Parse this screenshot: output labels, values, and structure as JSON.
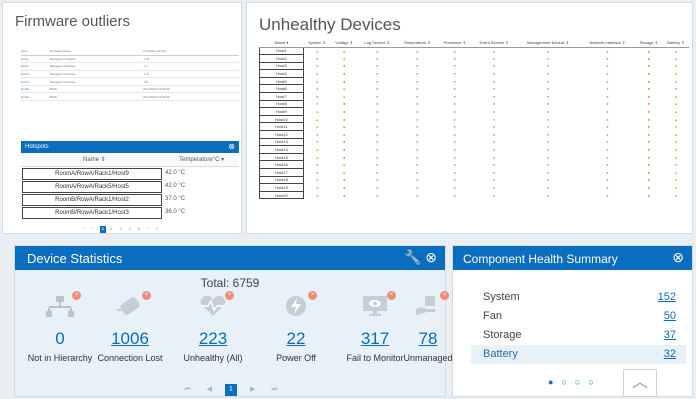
{
  "firmware": {
    "title": "Firmware outliers",
    "columns": [
      "Host",
      "Firmware Name",
      "Firmware Version"
    ],
    "rows": [
      [
        "Host1",
        "Manageent Module",
        "1.73"
      ],
      [
        "Host2",
        "Manageent Module",
        "1.7"
      ],
      [
        "Host3",
        "Manageent Module",
        "1.71"
      ],
      [
        "Host4",
        "Manageent Module",
        "1.8"
      ],
      [
        "Host5",
        "BIOS",
        "06.1234(07/1)/2016"
      ],
      [
        "Host6",
        "BIOS",
        "06.1234(07/1)/2016"
      ]
    ]
  },
  "hotspots": {
    "title": "Hotspots",
    "col_name": "Name ⇕",
    "col_temp": "Temperature°C ▾",
    "rows": [
      {
        "name": "RoomA/RowA/Rack1/Host9",
        "temp": "42.0 °C"
      },
      {
        "name": "RoomA/RowA/Rack5/Host5",
        "temp": "42.0 °C"
      },
      {
        "name": "RoomB/RowA/Rack1/Host2",
        "temp": "37.0 °C"
      },
      {
        "name": "RoomB/RowA/Rack1/Host3",
        "temp": "36.0 °C"
      }
    ],
    "pager": "‹ ‹",
    "pages": "2 3 4 5 › »",
    "current_page": "1"
  },
  "unhealthy": {
    "title": "Unhealthy Devices",
    "columns": [
      "Name ▾",
      "System ⇕",
      "Voltage ⇕",
      "Log Service ⇕",
      "Temperature ⇕",
      "Processor ⇕",
      "Event Service ⇕",
      "Management Module ⇕",
      "Network Interface ⇕",
      "Storage ⇕",
      "Battery ⇕"
    ],
    "hosts": [
      "Host1",
      "Host2",
      "Host3",
      "Host4",
      "Host5",
      "Host6",
      "Host7",
      "Host8",
      "Host9",
      "Host10",
      "Host11",
      "Host12",
      "Host13",
      "Host14",
      "Host15",
      "Host16",
      "Host17",
      "Host18",
      "Host19",
      "Host20"
    ]
  },
  "device_stats": {
    "title": "Device Statistics",
    "total": "Total: 6759",
    "items": [
      {
        "value": "0",
        "label": "Not in Hierarchy"
      },
      {
        "value": "1006",
        "label": "Connection Lost"
      },
      {
        "value": "223",
        "label": "Unhealthy (All)"
      },
      {
        "value": "22",
        "label": "Power Off"
      },
      {
        "value": "317",
        "label": "Fail to Monitor"
      },
      {
        "value": "78",
        "label": "Unmanaged"
      }
    ],
    "page": "1"
  },
  "component_health": {
    "title": "Component Health Summary",
    "rows": [
      {
        "label": "System",
        "value": "152"
      },
      {
        "label": "Fan",
        "value": "50"
      },
      {
        "label": "Storage",
        "value": "37"
      },
      {
        "label": "Battery",
        "value": "32"
      }
    ]
  },
  "colors": {
    "accent": "#0a6dbd",
    "ok": "#7fb99a",
    "warning": "#e8a83a",
    "error": "#e87a2a",
    "badge": "#f08b7a"
  }
}
